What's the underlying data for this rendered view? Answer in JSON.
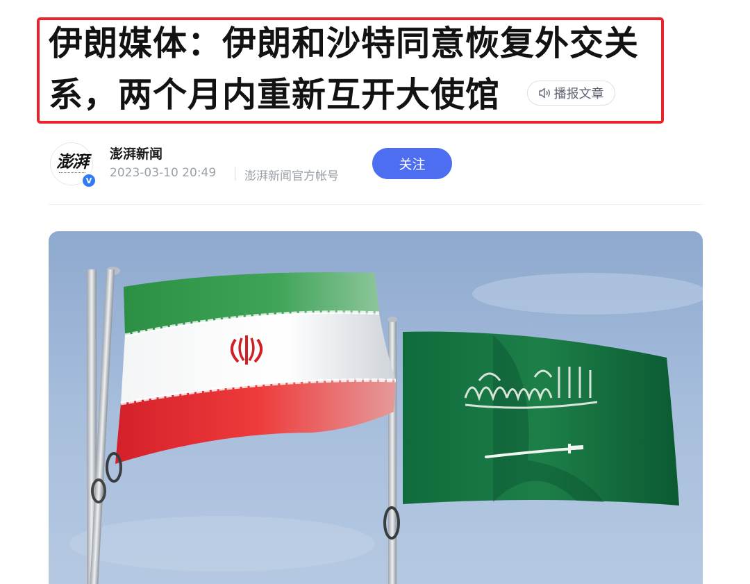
{
  "headline": {
    "line1": "伊朗媒体：伊朗和沙特同意恢复外交关",
    "line2": "系，两个月内重新互开大使馆",
    "listen_label": "播报文章"
  },
  "author": {
    "avatar_text": "澎湃",
    "name": "澎湃新闻",
    "timestamp": "2023-03-10 20:49",
    "account_desc": "澎湃新闻官方帐号",
    "follow_label": "关注",
    "verified_mark": "V"
  },
  "image": {
    "description_icon": "iran-saudi-flags-photo"
  },
  "colors": {
    "highlight_border": "#e8232a",
    "follow_button": "#4e6ef2",
    "verified": "#2f7cf6",
    "iran_green": "#239f40",
    "iran_red": "#da0000",
    "saudi_green": "#006c35"
  }
}
